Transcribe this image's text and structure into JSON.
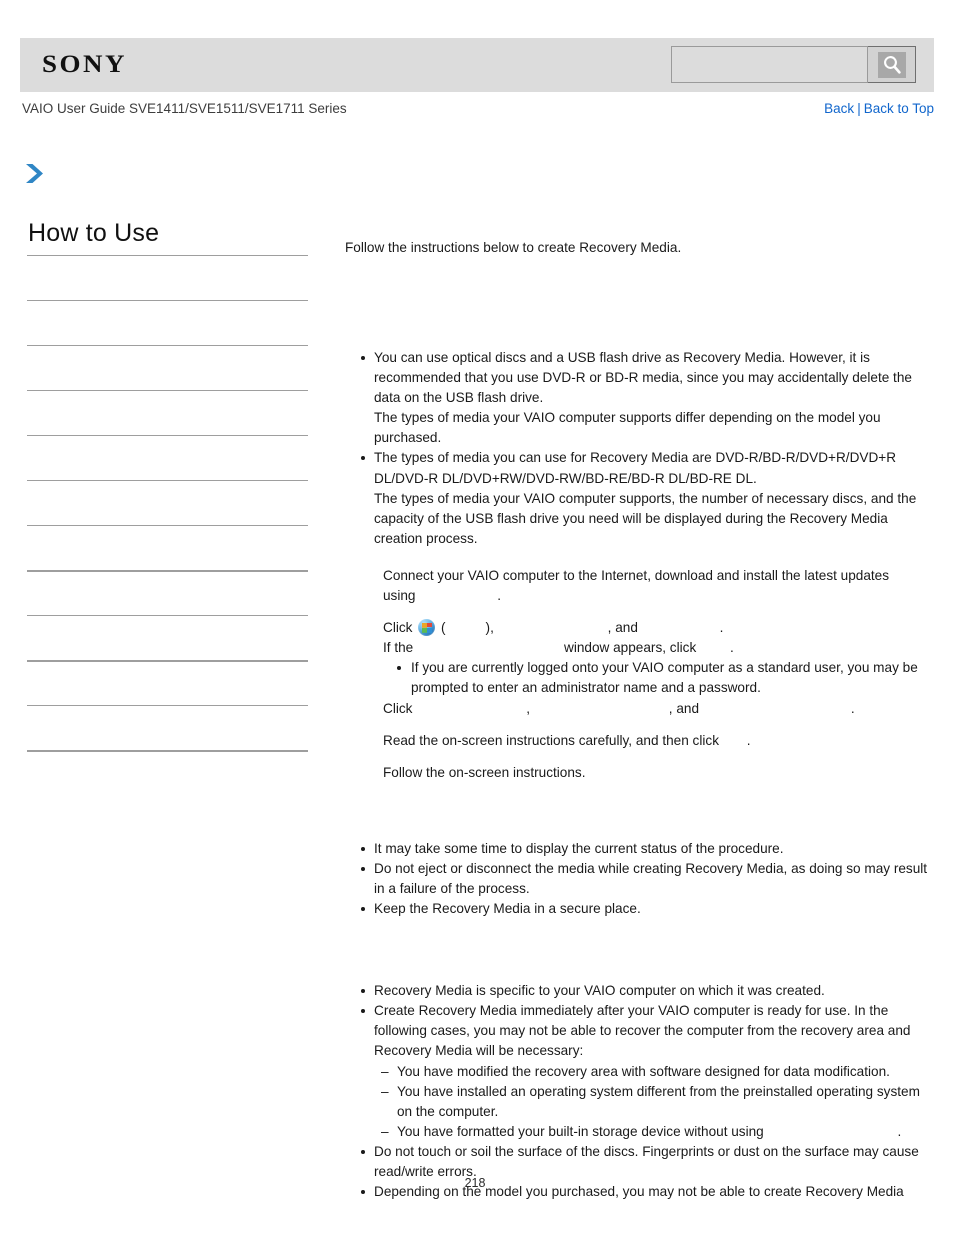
{
  "header": {
    "logo": "SONY",
    "search": {
      "value": "",
      "placeholder": "",
      "icon": "search-icon"
    }
  },
  "subheader": {
    "guide_title": "VAIO User Guide SVE1411/SVE1511/SVE1711 Series",
    "nav": {
      "back": "Back",
      "separator": "|",
      "back_to_top": "Back to Top"
    }
  },
  "sidebar": {
    "title": "How to Use",
    "items": [
      {
        "label": ""
      },
      {
        "label": ""
      },
      {
        "label": ""
      },
      {
        "label": ""
      },
      {
        "label": ""
      },
      {
        "label": ""
      },
      {
        "label": ""
      },
      {
        "label": ""
      },
      {
        "label": ""
      },
      {
        "label": ""
      },
      {
        "label": ""
      }
    ]
  },
  "content": {
    "intro": "Follow the instructions below to create Recovery Media.",
    "notes_media": [
      "You can use optical discs and a USB flash drive as Recovery Media. However, it is recommended that you use DVD-R or BD-R media, since you may accidentally delete the data on the USB flash drive.",
      "The types of media your VAIO computer supports differ depending on the model you purchased.",
      "The types of media you can use for Recovery Media are DVD-R/BD-R/DVD+R/DVD+R DL/DVD-R DL/DVD+RW/DVD-RW/BD-RE/BD-R DL/BD-RE DL.",
      "The types of media your VAIO computer supports, the number of necessary discs, and the capacity of the USB flash drive you need will be displayed during the Recovery Media creation process."
    ],
    "bullet1_line1": "You can use optical discs and a USB flash drive as Recovery Media. However, it is recommended that you use DVD-R or BD-R media, since you may accidentally delete the data on the USB flash drive.",
    "bullet1_line2": "The types of media your VAIO computer supports differ depending on the model you purchased.",
    "bullet2_line1": "The types of media you can use for Recovery Media are DVD-R/BD-R/DVD+R/DVD+R DL/DVD-R DL/DVD+RW/DVD-RW/BD-RE/BD-R DL/BD-RE DL.",
    "bullet2_line2": "The types of media your VAIO computer supports, the number of necessary discs, and the capacity of the USB flash drive you need will be displayed during the Recovery Media creation process.",
    "step1_a": "Connect your VAIO computer to the Internet, download and install the latest updates",
    "step1_b": "using",
    "step1_c": ".",
    "step2_a": "Click",
    "step2_b": "(",
    "step2_c": "),",
    "step2_d": ", and",
    "step2_e": ".",
    "step2_f": "If the",
    "step2_g": "window appears, click",
    "step2_h": ".",
    "step2_note": "If you are currently logged onto your VAIO computer as a standard user, you may be prompted to enter an administrator name and a password.",
    "step3_a": "Click",
    "step3_b": ",",
    "step3_c": ", and",
    "step3_d": ".",
    "step4": "Read the on-screen instructions carefully, and then click",
    "step4_end": ".",
    "step5": "Follow the on-screen instructions.",
    "notes_process": [
      "It may take some time to display the current status of the procedure.",
      "Do not eject or disconnect the media while creating Recovery Media, as doing so may result in a failure of the process.",
      "Keep the Recovery Media in a secure place."
    ],
    "notes_general": [
      "Recovery Media is specific to your VAIO computer on which it was created.",
      "Create Recovery Media immediately after your VAIO computer is ready for use. In the following cases, you may not be able to recover the computer from the recovery area and Recovery Media will be necessary:",
      "Do not touch or soil the surface of the discs. Fingerprints or dust on the surface may cause read/write errors.",
      "Depending on the model you purchased, you may not be able to create Recovery Media"
    ],
    "sub_dashes": [
      "You have modified the recovery area with software designed for data modification.",
      "You have installed an operating system different from the preinstalled operating system on the computer.",
      "You have formatted your built-in storage device without using"
    ],
    "sub_dash3_end": "."
  },
  "footer": {
    "page_number": "218"
  },
  "colors": {
    "header_bg": "#dcdcdc",
    "link": "#1166cc",
    "rule": "#9e9e9e",
    "arrow": "#2f86c5",
    "text": "#1a1a1a"
  }
}
